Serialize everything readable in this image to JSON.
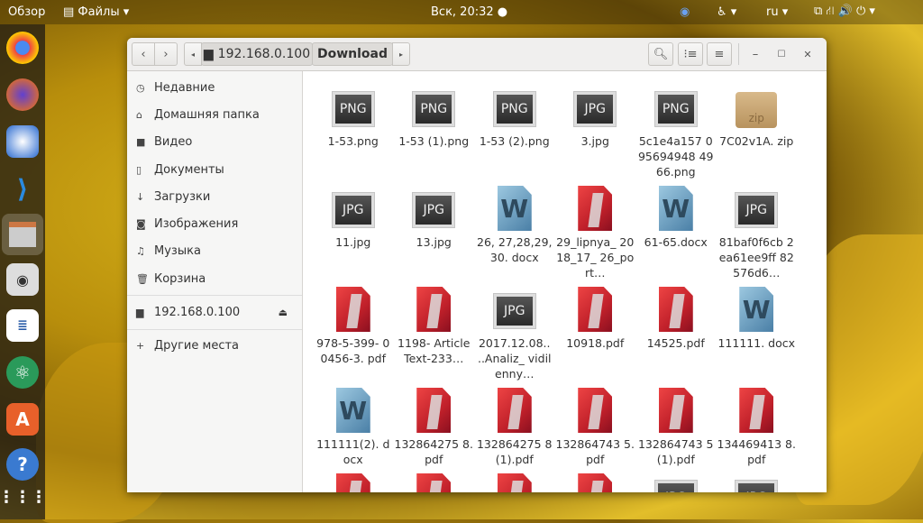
{
  "topbar": {
    "overview": "Обзор",
    "app": "Файлы ▾",
    "clock": "Вск, 20:32 ●",
    "lang": "ru ▾"
  },
  "window": {
    "path": [
      "192.168.0.100",
      "Download"
    ],
    "sidebar": [
      {
        "icon": "clock-icon",
        "glyph": "◷",
        "label": "Недавние"
      },
      {
        "icon": "home-icon",
        "glyph": "⌂",
        "label": "Домашняя папка"
      },
      {
        "icon": "video-icon",
        "glyph": "■",
        "label": "Видео"
      },
      {
        "icon": "document-icon",
        "glyph": "▯",
        "label": "Документы"
      },
      {
        "icon": "download-icon",
        "glyph": "↓",
        "label": "Загрузки"
      },
      {
        "icon": "camera-icon",
        "glyph": "◙",
        "label": "Изображения"
      },
      {
        "icon": "music-icon",
        "glyph": "♫",
        "label": "Музыка"
      },
      {
        "icon": "trash-icon",
        "glyph": "🗑",
        "label": "Корзина"
      },
      {
        "icon": "network-drive-icon",
        "glyph": "▆",
        "label": "192.168.0.100"
      },
      {
        "icon": "plus-icon",
        "glyph": "+",
        "label": "Другие места"
      }
    ],
    "files": [
      {
        "type": "png",
        "name": "1-53.png"
      },
      {
        "type": "png",
        "name": "1-53 (1).png"
      },
      {
        "type": "png",
        "name": "1-53 (2).png"
      },
      {
        "type": "jpg",
        "name": "3.jpg"
      },
      {
        "type": "png",
        "name": "5c1e4a157 095694948 4966.png"
      },
      {
        "type": "zip",
        "name": "7C02v1A. zip"
      },
      {
        "type": "jpg",
        "name": "11.jpg"
      },
      {
        "type": "jpg",
        "name": "13.jpg"
      },
      {
        "type": "docx",
        "name": "26, 27,28,29,30. docx"
      },
      {
        "type": "pdf",
        "name": "29_lipnya_ 2018_17_ 26_port…"
      },
      {
        "type": "docx",
        "name": "61-65.docx"
      },
      {
        "type": "jpg",
        "name": "81baf0f6cb 2ea61ee9ff 82576d6…"
      },
      {
        "type": "pdf",
        "name": "978-5-399- 00456-3. pdf"
      },
      {
        "type": "pdf",
        "name": "1198- Article Text-233…"
      },
      {
        "type": "jpg",
        "name": "2017.12.08.. ..Analiz_ vidilenny…"
      },
      {
        "type": "pdf",
        "name": "10918.pdf"
      },
      {
        "type": "pdf",
        "name": "14525.pdf"
      },
      {
        "type": "docx",
        "name": "111111. docx"
      },
      {
        "type": "docx",
        "name": "111111(2). docx"
      },
      {
        "type": "pdf",
        "name": "132864275 8.pdf"
      },
      {
        "type": "pdf",
        "name": "132864275 8 (1).pdf"
      },
      {
        "type": "pdf",
        "name": "132864743 5.pdf"
      },
      {
        "type": "pdf",
        "name": "132864743 5 (1).pdf"
      },
      {
        "type": "pdf",
        "name": "134469413 8.pdf"
      },
      {
        "type": "pdf",
        "name": ""
      },
      {
        "type": "pdf",
        "name": ""
      },
      {
        "type": "pdf",
        "name": ""
      },
      {
        "type": "pdf",
        "name": ""
      },
      {
        "type": "jpg",
        "name": ""
      },
      {
        "type": "jpg",
        "name": ""
      }
    ]
  }
}
